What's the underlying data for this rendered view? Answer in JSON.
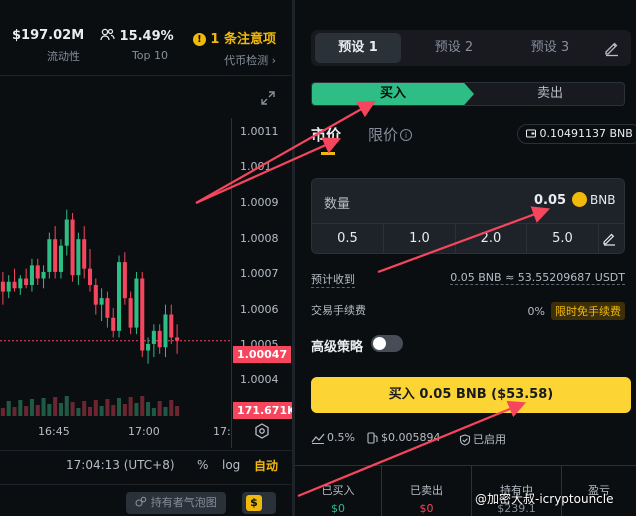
{
  "stats": {
    "liquidity_value": "$197.02M",
    "liquidity_label": "流动性",
    "top10_value": "15.49%",
    "top10_label": "Top 10",
    "warning_value": "1 条注意项",
    "warning_label": "代币检测 ›"
  },
  "price_axis": [
    "1.0011",
    "1.001",
    "1.0009",
    "1.0008",
    "1.0007",
    "1.0006",
    "1.0005",
    "1.0004"
  ],
  "current_price": "1.00047",
  "volume_label": "171.671K",
  "time_axis": [
    "16:45",
    "17:00",
    "17:"
  ],
  "bottom": {
    "timezone": "17:04:13 (UTC+8)",
    "percent": "%",
    "log": "log",
    "auto": "自动",
    "bubble": "持有者气泡图",
    "dollar": "$"
  },
  "presets": [
    "预设 1",
    "预设 2",
    "预设 3"
  ],
  "side": {
    "buy": "买入",
    "sell": "卖出"
  },
  "order_tabs": {
    "market": "市价",
    "limit": "限价"
  },
  "balance": "0.10491137 BNB",
  "quantity": {
    "label": "数量",
    "value": "0.05",
    "unit": "BNB",
    "options": [
      "0.5",
      "1.0",
      "2.0",
      "5.0"
    ]
  },
  "estimate": {
    "label": "预计收到",
    "value": "0.05 BNB ≈ 53.55209687 USDT"
  },
  "fee": {
    "label": "交易手续费",
    "value": "0%",
    "badge": "限时免手续费"
  },
  "advanced": {
    "label": "高级策略"
  },
  "buy_button": "买入 0.05 BNB ($53.58)",
  "meta": {
    "slippage": "0.5%",
    "gas": "$0.00589",
    "gas_suffix": "4",
    "mev": "已启用"
  },
  "holdings": [
    {
      "label": "已买入",
      "value": "$0",
      "color": "green"
    },
    {
      "label": "已卖出",
      "value": "$0",
      "color": "red"
    },
    {
      "label": "持有中",
      "value": "$239.1",
      "color": ""
    },
    {
      "label": "盈亏",
      "value": "",
      "color": ""
    }
  ],
  "watermark": "@加密大叔-icryptouncle",
  "colors": {
    "up": "#2ebd85",
    "down": "#f6465d",
    "accent": "#f0b90b",
    "button": "#fcd535"
  },
  "chart_data": {
    "type": "candlestick",
    "ylim": [
      1.00035,
      1.00115
    ],
    "candles": [
      {
        "o": 1.00065,
        "h": 1.00068,
        "l": 1.00058,
        "c": 1.00062
      },
      {
        "o": 1.00062,
        "h": 1.00067,
        "l": 1.0006,
        "c": 1.00065
      },
      {
        "o": 1.00065,
        "h": 1.00069,
        "l": 1.00062,
        "c": 1.00063
      },
      {
        "o": 1.00063,
        "h": 1.00067,
        "l": 1.00061,
        "c": 1.00066
      },
      {
        "o": 1.00066,
        "h": 1.00069,
        "l": 1.00063,
        "c": 1.00064
      },
      {
        "o": 1.00064,
        "h": 1.00072,
        "l": 1.00062,
        "c": 1.0007
      },
      {
        "o": 1.0007,
        "h": 1.00072,
        "l": 1.00064,
        "c": 1.00066
      },
      {
        "o": 1.00066,
        "h": 1.0007,
        "l": 1.00063,
        "c": 1.00068
      },
      {
        "o": 1.00068,
        "h": 1.0008,
        "l": 1.00066,
        "c": 1.00078
      },
      {
        "o": 1.00078,
        "h": 1.00082,
        "l": 1.00066,
        "c": 1.00068
      },
      {
        "o": 1.00068,
        "h": 1.00078,
        "l": 1.00066,
        "c": 1.00076
      },
      {
        "o": 1.00076,
        "h": 1.00087,
        "l": 1.00073,
        "c": 1.00084
      },
      {
        "o": 1.00084,
        "h": 1.00086,
        "l": 1.00065,
        "c": 1.00067
      },
      {
        "o": 1.00067,
        "h": 1.0008,
        "l": 1.00064,
        "c": 1.00078
      },
      {
        "o": 1.00078,
        "h": 1.00082,
        "l": 1.00066,
        "c": 1.00069
      },
      {
        "o": 1.00069,
        "h": 1.00075,
        "l": 1.00062,
        "c": 1.00064
      },
      {
        "o": 1.00064,
        "h": 1.00066,
        "l": 1.00055,
        "c": 1.00058
      },
      {
        "o": 1.00058,
        "h": 1.00063,
        "l": 1.00053,
        "c": 1.0006
      },
      {
        "o": 1.0006,
        "h": 1.00062,
        "l": 1.00051,
        "c": 1.00054
      },
      {
        "o": 1.00054,
        "h": 1.00057,
        "l": 1.00048,
        "c": 1.0005
      },
      {
        "o": 1.0005,
        "h": 1.00073,
        "l": 1.00048,
        "c": 1.00071
      },
      {
        "o": 1.00071,
        "h": 1.00074,
        "l": 1.00058,
        "c": 1.0006
      },
      {
        "o": 1.0006,
        "h": 1.00062,
        "l": 1.00049,
        "c": 1.00051
      },
      {
        "o": 1.00051,
        "h": 1.00068,
        "l": 1.00049,
        "c": 1.00066
      },
      {
        "o": 1.00066,
        "h": 1.00068,
        "l": 1.00042,
        "c": 1.00044
      },
      {
        "o": 1.00044,
        "h": 1.00048,
        "l": 1.0004,
        "c": 1.00046
      },
      {
        "o": 1.00046,
        "h": 1.00052,
        "l": 1.00042,
        "c": 1.0005
      },
      {
        "o": 1.0005,
        "h": 1.00052,
        "l": 1.00043,
        "c": 1.00045
      },
      {
        "o": 1.00045,
        "h": 1.00058,
        "l": 1.00042,
        "c": 1.00055
      },
      {
        "o": 1.00055,
        "h": 1.00058,
        "l": 1.00046,
        "c": 1.00048
      },
      {
        "o": 1.00048,
        "h": 1.00052,
        "l": 1.00043,
        "c": 1.00047
      }
    ]
  }
}
